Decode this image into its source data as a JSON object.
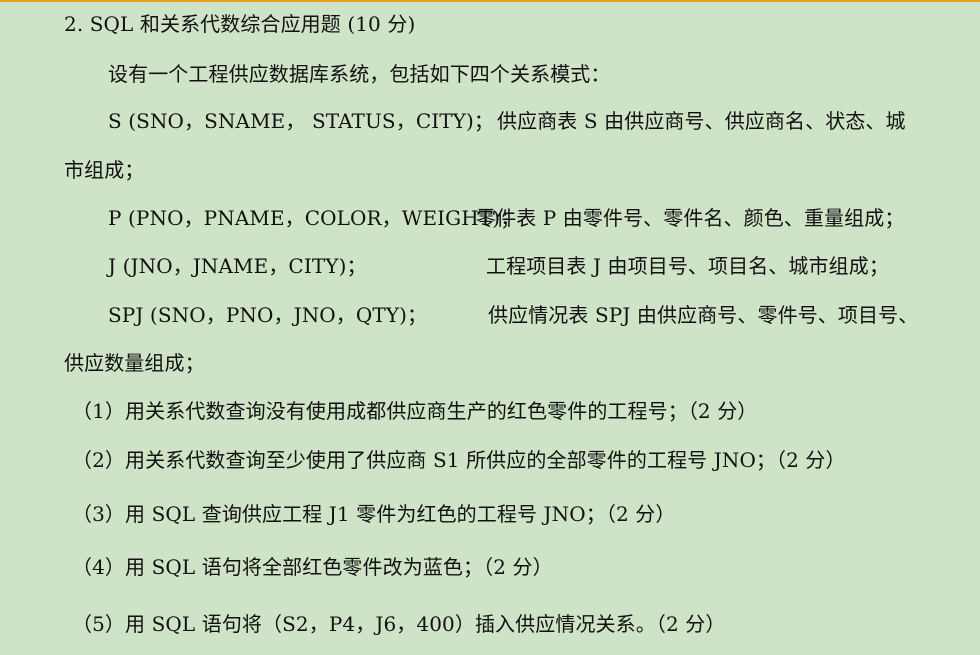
{
  "document": {
    "heading": "2. SQL 和关系代数综合应用题 (10 分)",
    "intro": "设有一个工程供应数据库系统，包括如下四个关系模式：",
    "schemas": {
      "s_decl": "S (SNO，SNAME，  STATUS，CITY)；",
      "s_desc": "供应商表 S 由供应商号、供应商名、状态、城",
      "s_desc_cont": "市组成；",
      "p_decl": "P (PNO，PNAME，COLOR，WEIGHT)；",
      "p_desc": "零件表 P  由零件号、零件名、颜色、重量组成；",
      "j_decl": "J (JNO，JNAME，CITY)；",
      "j_desc": "工程项目表 J 由项目号、项目名、城市组成；",
      "spj_decl": "SPJ (SNO，PNO，JNO，QTY)；",
      "spj_desc": "供应情况表 SPJ 由供应商号、零件号、项目号、",
      "spj_desc_cont": "供应数量组成；"
    },
    "questions": [
      "（1）用关系代数查询没有使用成都供应商生产的红色零件的工程号；（2 分）",
      "（2）用关系代数查询至少使用了供应商 S1 所供应的全部零件的工程号 JNO；（2 分）",
      "（3）用 SQL 查询供应工程 J1 零件为红色的工程号 JNO；（2 分）",
      "（4）用 SQL 语句将全部红色零件改为蓝色；（2 分）",
      "（5）用 SQL 语句将（S2，P4，J6，400）插入供应情况关系。（2 分）"
    ]
  }
}
